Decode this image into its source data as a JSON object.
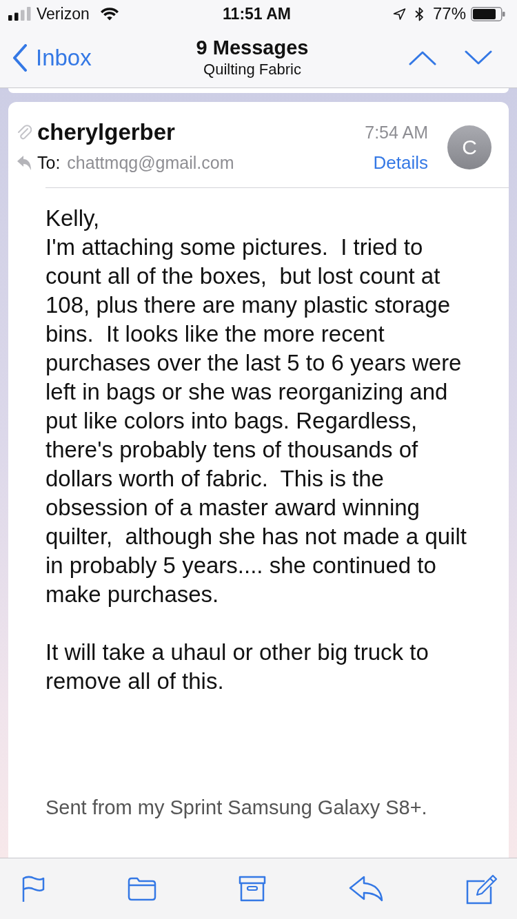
{
  "status_bar": {
    "carrier": "Verizon",
    "time": "11:51 AM",
    "battery": "77%"
  },
  "nav_bar": {
    "back_label": "Inbox",
    "title": "9 Messages",
    "subtitle": "Quilting Fabric"
  },
  "message": {
    "sender": "cherylgerber",
    "time": "7:54 AM",
    "to_label": "To:",
    "recipient": "chattmqg@gmail.com",
    "details_label": "Details",
    "avatar_initial": "C",
    "has_attachment": true,
    "replied": true,
    "body": [
      "Kelly,\nI'm attaching some pictures.  I tried to\ncount all of the boxes,  but lost count at\n108, plus there are many plastic storage\nbins.  It looks like the more recent\npurchases over the last 5 to 6 years were\nleft in bags or she was reorganizing and\nput like colors into bags. Regardless,\nthere's probably tens of thousands of\ndollars worth of fabric.  This is the\nobsession of a master award winning\nquilter,  although she has not made a quilt\nin probably 5 years.... she continued to\nmake purchases.",
      "It will take a uhaul or other big truck to\nremove all of this."
    ],
    "signature": "Sent from my Sprint Samsung Galaxy S8+."
  }
}
